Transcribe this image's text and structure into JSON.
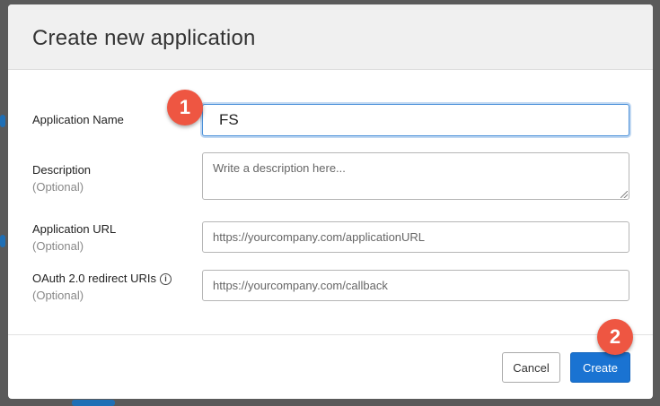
{
  "dialog": {
    "title": "Create new application",
    "fields": {
      "app_name": {
        "label": "Application Name",
        "value": "FS"
      },
      "description": {
        "label": "Description",
        "optional": "(Optional)",
        "placeholder": "Write a description here..."
      },
      "app_url": {
        "label": "Application URL",
        "optional": "(Optional)",
        "placeholder": "https://yourcompany.com/applicationURL"
      },
      "redirect_uris": {
        "label": "OAuth 2.0 redirect URIs",
        "optional": "(Optional)",
        "placeholder": "https://yourcompany.com/callback",
        "info_icon": "info-icon"
      }
    },
    "buttons": {
      "cancel": "Cancel",
      "create": "Create"
    }
  },
  "annotations": {
    "step1": "1",
    "step2": "2"
  },
  "colors": {
    "accent": "#1a73d2",
    "badge": "#ee5642",
    "header_bg": "#f0f0f0"
  }
}
